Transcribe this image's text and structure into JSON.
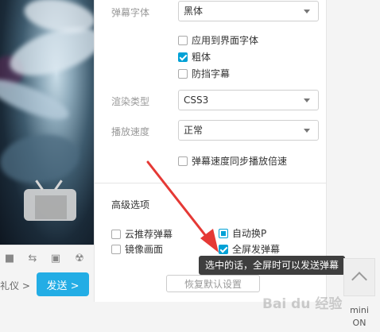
{
  "player": {
    "etiquette_text": "礼仪 >",
    "send_label": "发送 >"
  },
  "settings": {
    "danmaku_font": {
      "label": "弹幕字体",
      "value": "黑体"
    },
    "font_options": [
      {
        "label": "应用到界面字体",
        "checked": false
      },
      {
        "label": "粗体",
        "checked": true
      },
      {
        "label": "防挡字幕",
        "checked": false
      }
    ],
    "render_type": {
      "label": "渲染类型",
      "value": "CSS3"
    },
    "play_speed": {
      "label": "播放速度",
      "value": "正常"
    },
    "speed_sync": {
      "label": "弹幕速度同步播放倍速",
      "checked": false
    },
    "advanced": {
      "title": "高级选项",
      "options": [
        {
          "label": "云推荐弹幕",
          "checked": false
        },
        {
          "label": "自动换P",
          "checked": true
        },
        {
          "label": "镜像画面",
          "checked": false
        },
        {
          "label": "全屏发弹幕",
          "checked": true
        }
      ]
    },
    "reset_label": "恢复默认设置"
  },
  "tooltip": "选中的话，全屏时可以发送弹幕",
  "sidebar": {
    "mini_label": "mini",
    "on_label": "ON"
  },
  "watermark": "Bai du 经验",
  "colors": {
    "accent": "#00a1d6",
    "send": "#23ade5",
    "arrow": "#e53935"
  }
}
